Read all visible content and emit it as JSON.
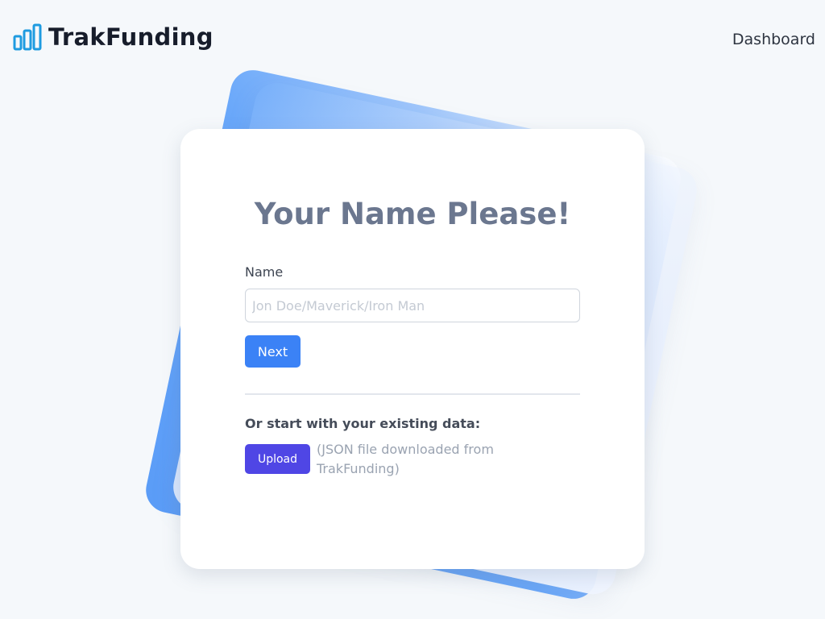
{
  "header": {
    "brand": "TrakFunding",
    "nav_dashboard": "Dashboard"
  },
  "form": {
    "title": "Your Name Please!",
    "name_label": "Name",
    "name_placeholder": "Jon Doe/Maverick/Iron Man",
    "name_value": "",
    "next_label": "Next",
    "existing_label": "Or start with your existing data:",
    "upload_label": "Upload",
    "upload_hint": "(JSON file downloaded from TrakFunding)"
  },
  "icons": {
    "logo": "bar-chart-icon"
  },
  "colors": {
    "background": "#f5f8fb",
    "logo_blue": "#1e9be0",
    "next_button": "#3b82f6",
    "upload_button": "#4f46e5",
    "title": "#6b778f"
  }
}
